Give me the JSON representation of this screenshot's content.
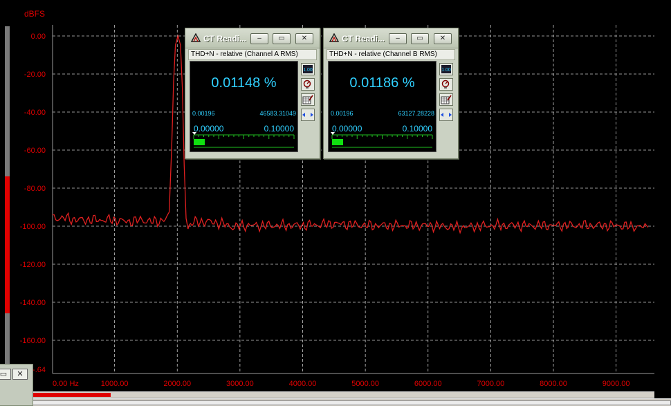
{
  "graph": {
    "ylabel": "dBFS",
    "yticks": [
      "0.00",
      "-20.00",
      "-40.00",
      "-60.00",
      "-80.00",
      "-100.00",
      "-120.00",
      "-140.00",
      "-160.00",
      "-.64"
    ],
    "xticks": [
      "0.00 Hz",
      "1000.00",
      "2000.00",
      "3000.00",
      "4000.00",
      "5000.00",
      "6000.00",
      "7000.00",
      "8000.00",
      "9000.00"
    ],
    "colors": {
      "trace": "#e02020",
      "grid": "#c8c8c8",
      "labels": "#e00000"
    }
  },
  "chart_data": {
    "type": "line",
    "xlabel": "",
    "ylabel": "dBFS",
    "xlim": [
      0,
      9600
    ],
    "ylim": [
      -176,
      4
    ],
    "grid": true,
    "series": [
      {
        "x": [
          0,
          200,
          400,
          600,
          800,
          1000,
          1200,
          1400,
          1600,
          1800,
          1860,
          1900,
          1930,
          1960,
          2000,
          2040,
          2070,
          2100,
          2130,
          2160,
          2200,
          2300,
          2500,
          2700,
          2900,
          3000,
          3200,
          3500,
          4000,
          4500,
          5000,
          5500,
          6000,
          6500,
          7000,
          7500,
          8000,
          8500,
          9000,
          9500
        ],
        "y": [
          -98,
          -98,
          -99,
          -99,
          -99,
          -99,
          -100,
          -99,
          -100,
          -99,
          -94,
          -60,
          -25,
          -5,
          0,
          -5,
          -28,
          -70,
          -100,
          -102,
          -101,
          -100,
          -100,
          -101,
          -103,
          -102,
          -102,
          -102,
          -102,
          -101,
          -102,
          -102,
          -102,
          -103,
          -102,
          -102,
          -102,
          -102,
          -102,
          -103
        ]
      }
    ]
  },
  "readout_a": {
    "title": "CT Readi...",
    "subtitle": "THD+N - relative (Channel A RMS)",
    "value": "0.01148 %",
    "min": "0.00196",
    "max": "46583.31049",
    "scale_lo": "0.00000",
    "scale_hi": "0.10000",
    "level": 0.1
  },
  "readout_b": {
    "title": "CT Readi...",
    "subtitle": "THD+N - relative (Channel B RMS)",
    "value": "0.01186 %",
    "min": "0.00196",
    "max": "63127.28228",
    "scale_lo": "0.00000",
    "scale_hi": "0.10000",
    "level": 0.1
  },
  "buttons": {
    "minimize": "–",
    "restore": "▭",
    "close": "✕",
    "digits": "1.00"
  }
}
